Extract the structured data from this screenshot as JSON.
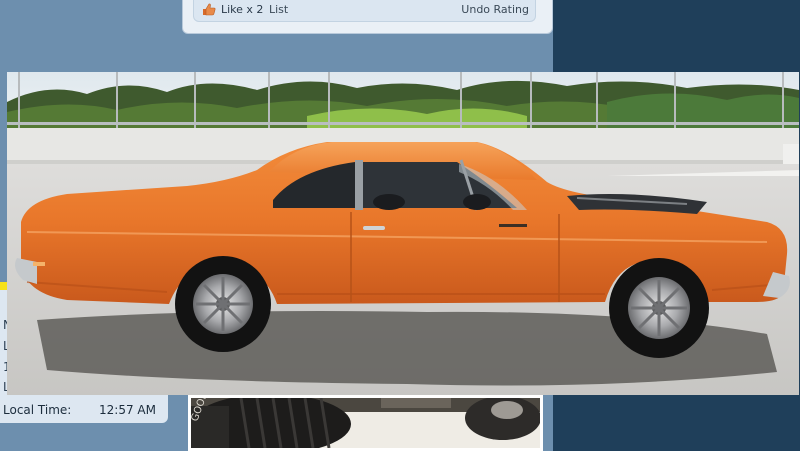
{
  "post": {
    "like_label": "Like x 2",
    "list_label": "List",
    "undo_label": "Undo Rating"
  },
  "userinfo": {
    "line_initials": [
      "N",
      "L",
      "1",
      "L"
    ],
    "local_time_label": "Local Time:",
    "local_time_value": "12:57 AM"
  },
  "photo": {
    "subject": "orange-muscle-car-side-view",
    "body_color": "#e8762a",
    "background": "rooftop-parking-with-trees"
  },
  "colors": {
    "page_bg": "#1f3f59",
    "forum_bg": "#6d8fae",
    "footer_bg": "#eaf0f6",
    "accent_yellow": "#f6e21a"
  }
}
